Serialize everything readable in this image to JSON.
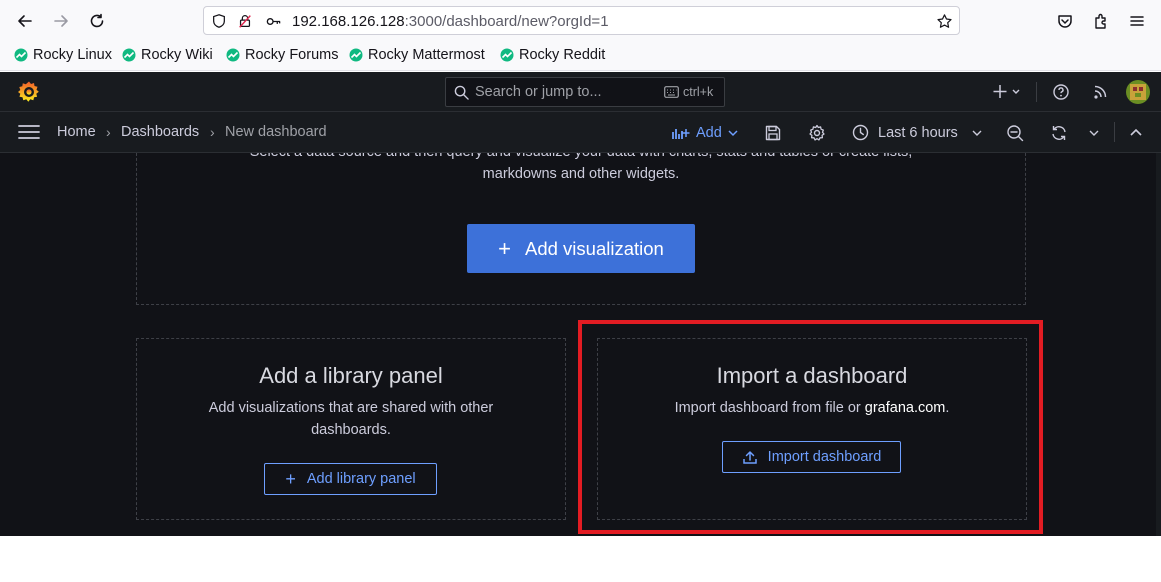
{
  "browser": {
    "url_host": "192.168.126.128",
    "url_path": ":3000/dashboard/new?orgId=1",
    "bookmarks": [
      "Rocky Linux",
      "Rocky Wiki",
      "Rocky Forums",
      "Rocky Mattermost",
      "Rocky Reddit"
    ]
  },
  "grafana": {
    "search": {
      "placeholder": "Search or jump to...",
      "shortcut": "ctrl+k"
    },
    "breadcrumb": [
      "Home",
      "Dashboards",
      "New dashboard"
    ],
    "toolbar": {
      "add_label": "Add",
      "time_range": "Last 6 hours"
    },
    "visualization_card": {
      "description_line1": "Select a data source and then query and visualize your data with charts, stats and tables or create lists,",
      "description_line2": "markdowns and other widgets.",
      "button": "Add visualization"
    },
    "library_card": {
      "title": "Add a library panel",
      "description_line1": "Add visualizations that are shared with other",
      "description_line2": "dashboards.",
      "button": "Add library panel"
    },
    "import_card": {
      "title": "Import a dashboard",
      "description_prefix": "Import dashboard from file or ",
      "description_link": "grafana.com",
      "description_suffix": ".",
      "button": "Import dashboard"
    }
  },
  "colors": {
    "highlight": "#e31c23",
    "primary": "#3d71d9",
    "link": "#6e9fff",
    "background": "#111217"
  }
}
